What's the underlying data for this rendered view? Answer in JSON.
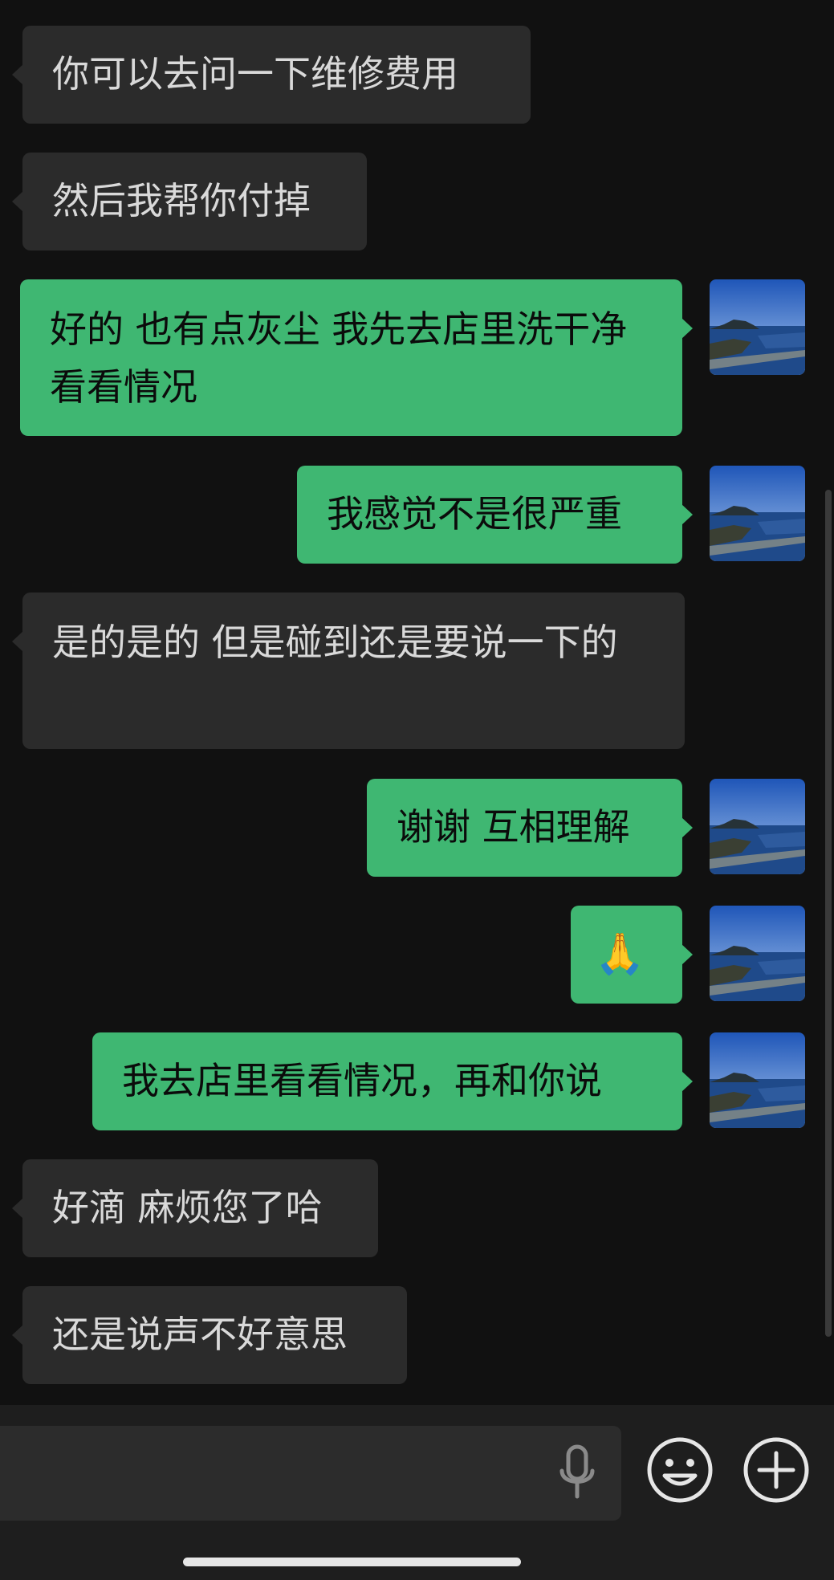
{
  "messages": [
    {
      "side": "left",
      "text": "你可以去问一下维修费用"
    },
    {
      "side": "left",
      "text": "然后我帮你付掉"
    },
    {
      "side": "right",
      "text": "好的 也有点灰尘 我先去店里洗干净看看情况"
    },
    {
      "side": "right",
      "text": "我感觉不是很严重"
    },
    {
      "side": "left",
      "text": "是的是的 但是碰到还是要说一下的"
    },
    {
      "side": "right",
      "text": "谢谢 互相理解"
    },
    {
      "side": "right",
      "text": "🙏"
    },
    {
      "side": "right",
      "text": "我去店里看看情况，再和你说"
    },
    {
      "side": "left",
      "text": "好滴 麻烦您了哈"
    },
    {
      "side": "left",
      "text": "还是说声不好意思"
    }
  ],
  "input": {
    "value": "",
    "voice_icon": "microphone-icon",
    "emoji_icon": "smiley-face-icon",
    "more_icon": "plus-circle-icon"
  },
  "colors": {
    "background": "#111111",
    "incoming_bubble": "#2b2b2b",
    "outgoing_bubble": "#3fb772",
    "input_bar": "#1e1e1e"
  }
}
